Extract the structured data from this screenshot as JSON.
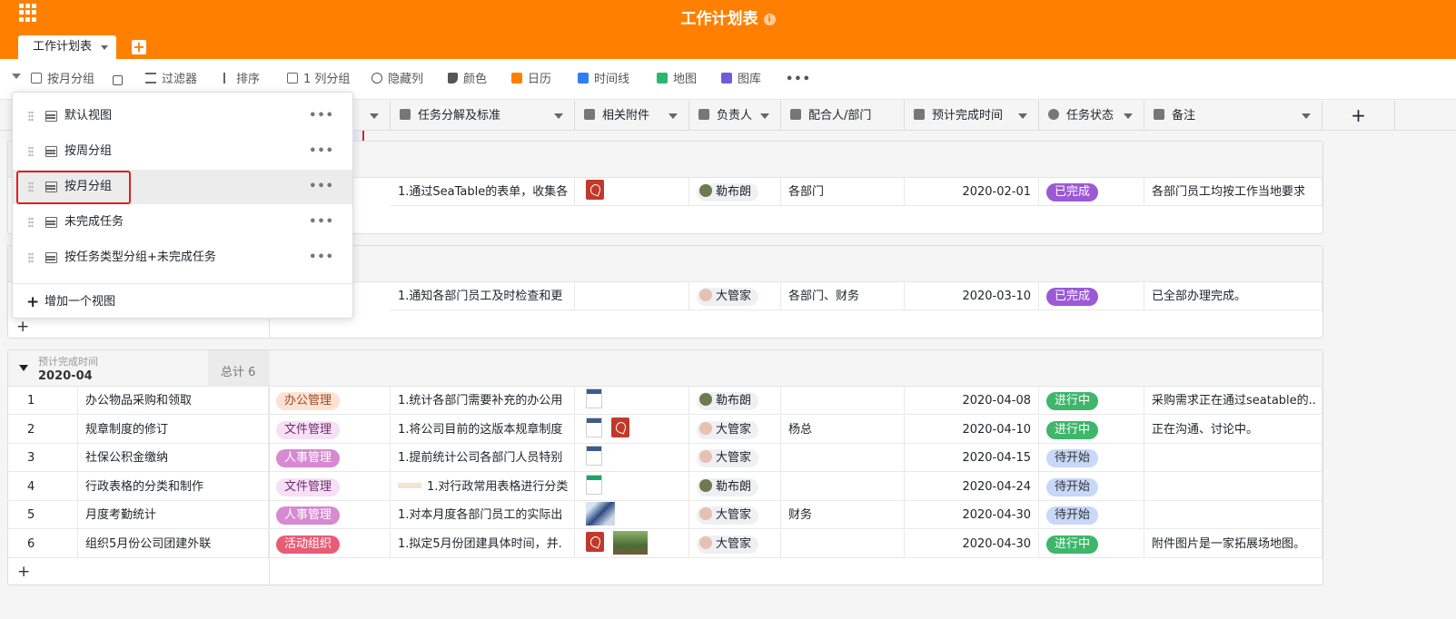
{
  "app": {
    "title": "工作计划表"
  },
  "tabs": [
    {
      "label": "工作计划表"
    }
  ],
  "toolbar": {
    "view": "按月分组",
    "filter": "过滤器",
    "sort": "排序",
    "group": "1 列分组",
    "hide": "隐藏列",
    "color": "颜色",
    "calendar": "日历",
    "timeline": "时间线",
    "map": "地图",
    "gallery": "图库",
    "more": "•••"
  },
  "view_menu": {
    "items": [
      {
        "label": "默认视图"
      },
      {
        "label": "按周分组"
      },
      {
        "label": "按月分组",
        "selected": true
      },
      {
        "label": "未完成任务"
      },
      {
        "label": "按任务类型分组+未完成任务"
      }
    ],
    "add_label": "增加一个视图",
    "more": "•••"
  },
  "columns": [
    {
      "name": "任务分解及标准"
    },
    {
      "name": "相关附件"
    },
    {
      "name": "负责人"
    },
    {
      "name": "配合人/部门"
    },
    {
      "name": "预计完成时间"
    },
    {
      "name": "任务状态"
    },
    {
      "name": "备注"
    }
  ],
  "groups": [
    {
      "rows": [
        {
          "standard": "1.通过SeaTable的表单，收集各",
          "attachments": [
            "pdf"
          ],
          "owner": "勒布朗",
          "partner": "各部门",
          "due": "2020-02-01",
          "status": "已完成",
          "note": "各部门员工均按工作当地要求"
        }
      ]
    },
    {
      "rows": [
        {
          "standard": "1.通知各部门员工及时检查和更",
          "attachments": [],
          "owner": "大管家",
          "partner": "各部门、财务",
          "due": "2020-03-10",
          "status": "已完成",
          "note": "已全部办理完成。"
        }
      ]
    },
    {
      "field": "预计完成时间",
      "value": "2020-04",
      "count_label": "总计 6",
      "rows": [
        {
          "no": "1",
          "task": "办公物品采购和领取",
          "type": "办公管理",
          "standard": "1.统计各部门需要补充的办公用",
          "attachments": [
            "doc"
          ],
          "owner": "勒布朗",
          "partner": "",
          "due": "2020-04-08",
          "status": "进行中",
          "note": "采购需求正在通过seatable的.."
        },
        {
          "no": "2",
          "task": "规章制度的修订",
          "type": "文件管理",
          "standard": "1.将公司目前的这版本规章制度",
          "attachments": [
            "doc",
            "pdf"
          ],
          "owner": "大管家",
          "partner": "杨总",
          "due": "2020-04-10",
          "status": "进行中",
          "note": "正在沟通、讨论中。"
        },
        {
          "no": "3",
          "task": "社保公积金缴纳",
          "type": "人事管理",
          "standard": "1.提前统计公司各部门人员特别",
          "attachments": [
            "doc"
          ],
          "owner": "大管家",
          "partner": "",
          "due": "2020-04-15",
          "status": "待开始",
          "note": ""
        },
        {
          "no": "4",
          "task": "行政表格的分类和制作",
          "type": "文件管理",
          "standard": "1.对行政常用表格进行分类",
          "attachments": [
            "xls"
          ],
          "owner": "勒布朗",
          "partner": "",
          "due": "2020-04-24",
          "status": "待开始",
          "note": ""
        },
        {
          "no": "5",
          "task": "月度考勤统计",
          "type": "人事管理",
          "standard": "1.对本月度各部门员工的实际出",
          "attachments": [
            "img"
          ],
          "owner": "大管家",
          "partner": "财务",
          "due": "2020-04-30",
          "status": "待开始",
          "note": ""
        },
        {
          "no": "6",
          "task": "组织5月份公司团建外联",
          "type": "活动组织",
          "standard": "1.拟定5月份团建具体时间，并.",
          "attachments": [
            "pdf",
            "img"
          ],
          "owner": "大管家",
          "partner": "",
          "due": "2020-04-30",
          "status": "进行中",
          "note": "附件图片是一家拓展场地图。"
        }
      ]
    }
  ],
  "colors": {
    "header": "#ff8000",
    "done": "#9b59d6",
    "doing": "#3fb66b",
    "todo": "#c7d8f8",
    "highlight": "#e02020"
  }
}
